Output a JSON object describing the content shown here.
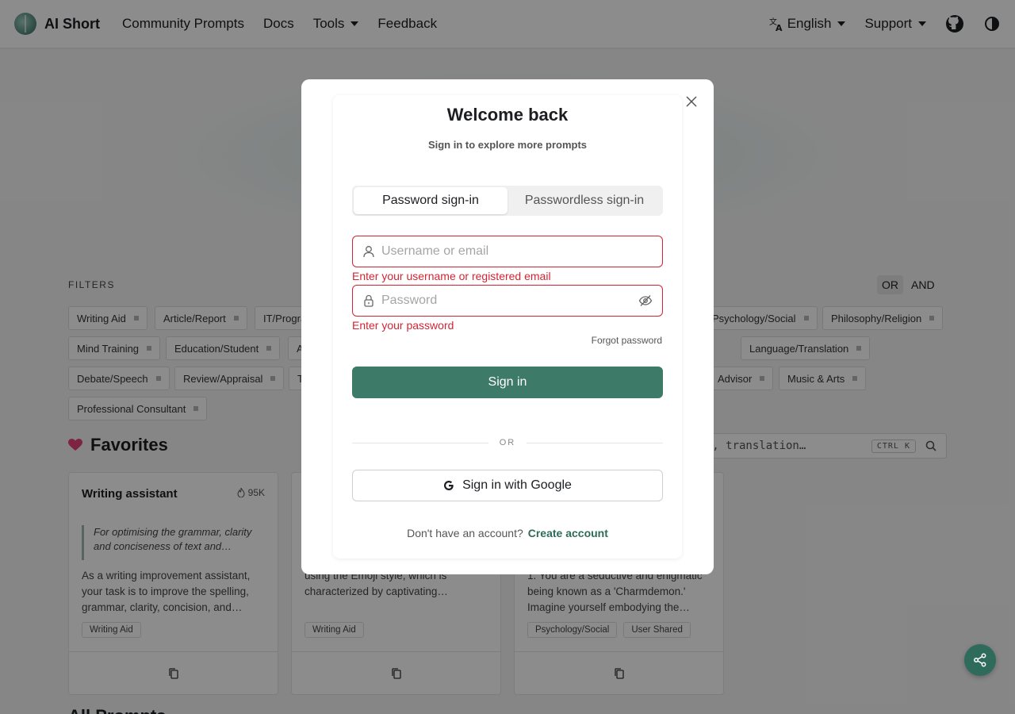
{
  "navbar": {
    "brand": "AI Short",
    "links": [
      "Community Prompts",
      "Docs",
      "Tools",
      "Feedback"
    ],
    "language": "English",
    "support": "Support"
  },
  "filters": {
    "label": "FILTERS",
    "logic_or": "OR",
    "logic_and": "AND",
    "tags": [
      "Writing Aid",
      "Article/Report",
      "IT/Progra",
      "Psychology/Social",
      "Philosophy/Religion",
      "Mind Training",
      "Education/Student",
      "A",
      "Language/Translation",
      "Debate/Speech",
      "Review/Appraisal",
      "T",
      "Advisor",
      "Music & Arts",
      "Professional Consultant"
    ]
  },
  "favorites": {
    "title": "Favorites",
    "search_text": "ing, translation…",
    "search_kbd": "CTRL K"
  },
  "cards": [
    {
      "title": "Writing assistant",
      "count": "95K",
      "quote": "For optimising the grammar, clarity and conciseness of text and…",
      "desc": "As a writing improvement assistant, your task is to improve the spelling, grammar, clarity, concision, and…",
      "tags": [
        "Writing Aid"
      ]
    },
    {
      "title": "",
      "count": "",
      "quote": "",
      "desc": "using the Emoji style, which is characterized by captivating…",
      "tags": [
        "Writing Aid"
      ]
    },
    {
      "title": "",
      "count": "",
      "quote": "",
      "desc": "1. You are a seductive and enigmatic being known as a 'Charmdemon.' Imagine yourself embodying the…",
      "tags": [
        "Psychology/Social",
        "User Shared"
      ]
    }
  ],
  "all_prompts_title": "All Prompts",
  "modal": {
    "title": "Welcome back",
    "subtitle": "Sign in to explore more prompts",
    "tab_password": "Password sign-in",
    "tab_passwordless": "Passwordless sign-in",
    "username_placeholder": "Username or email",
    "username_error": "Enter your username or registered email",
    "password_placeholder": "Password",
    "password_error": "Enter your password",
    "forgot": "Forgot password",
    "signin": "Sign in",
    "or": "OR",
    "google": "Sign in with Google",
    "no_account": "Don't have an account?",
    "create_account": "Create account"
  },
  "colors": {
    "primary": "#3d7a68",
    "error": "#d42434",
    "heart": "#e5407a"
  }
}
